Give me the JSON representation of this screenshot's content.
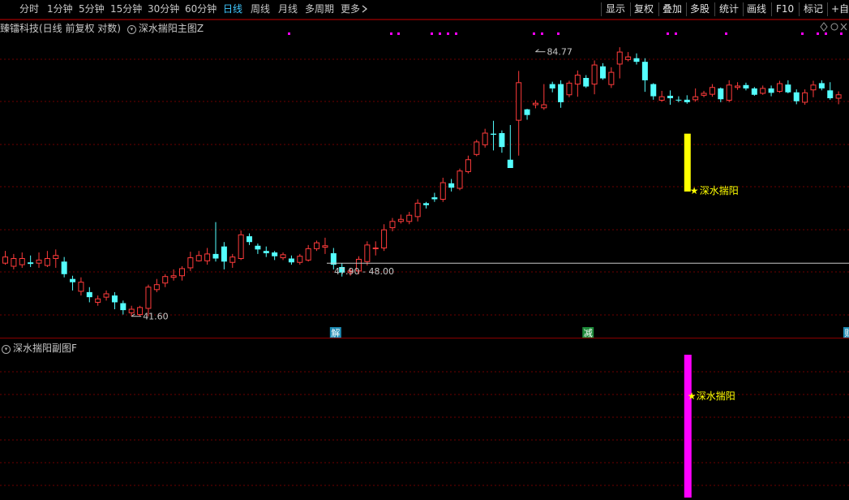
{
  "toolbar": {
    "periods": [
      "分时",
      "1分钟",
      "5分钟",
      "15分钟",
      "30分钟",
      "60分钟",
      "日线",
      "周线",
      "月线",
      "多周期",
      "更多"
    ],
    "active_period": "日线",
    "more_icon": "chevron-right-icon",
    "right_buttons": [
      "显示",
      "复权",
      "叠加",
      "多股",
      "统计",
      "画线",
      "F10",
      "标记",
      "+自选"
    ]
  },
  "main_title": "臻镭科技(日线 前复权 对数)",
  "main_indicator": "深水揣阳主图Z",
  "sub_indicator": "深水揣阳副图F",
  "right_icons": [
    "diamond-icon",
    "circle-icon",
    "close-icon"
  ],
  "colors": {
    "up": "#ff3b3b",
    "down": "#54ffff",
    "signal_main": "#ffff00",
    "signal_sub": "#ff00ff",
    "star": "#ffff00",
    "grid": "#6e0000",
    "event": "#1e8bb4"
  },
  "annotations": {
    "high_label": "84.77",
    "low_label": "41.60",
    "range_label": "47.90 - 48.00",
    "main_signal_label": "深水揣阳",
    "sub_signal_label": "深水揣阳"
  },
  "events": [
    {
      "label": "解",
      "color": "#1e8bb4",
      "index": 39
    },
    {
      "label": "减",
      "color": "#1e8b3a",
      "index": 69
    },
    {
      "label": "财",
      "color": "#1e8bb4",
      "index": 100
    }
  ],
  "chart_data": {
    "type": "candlestick",
    "scale": "log",
    "ylim": [
      40.5,
      88.5
    ],
    "high": 84.77,
    "low": 41.6,
    "signal_index": 81,
    "candles": [
      [
        48.0,
        48.8,
        49.6,
        47.8
      ],
      [
        47.6,
        48.6,
        49.2,
        47.2
      ],
      [
        47.8,
        48.6,
        49.4,
        47.4
      ],
      [
        48.1,
        47.9,
        49.0,
        47.5
      ],
      [
        48.0,
        48.4,
        49.4,
        47.4
      ],
      [
        47.7,
        48.6,
        49.6,
        47.5
      ],
      [
        48.6,
        49.0,
        49.8,
        47.4
      ],
      [
        48.2,
        46.6,
        48.8,
        46.2
      ],
      [
        46.0,
        45.6,
        46.4,
        44.6
      ],
      [
        44.5,
        45.6,
        46.2,
        44.0
      ],
      [
        44.4,
        43.8,
        45.0,
        43.2
      ],
      [
        43.2,
        43.6,
        44.0,
        42.8
      ],
      [
        43.8,
        44.2,
        44.6,
        43.4
      ],
      [
        44.0,
        43.2,
        44.4,
        42.4
      ],
      [
        43.1,
        42.3,
        43.4,
        41.8
      ],
      [
        42.0,
        42.4,
        42.8,
        41.6
      ],
      [
        41.8,
        42.6,
        42.8,
        41.6
      ],
      [
        42.5,
        45.0,
        45.3,
        41.6
      ],
      [
        44.7,
        45.3,
        46.0,
        44.4
      ],
      [
        45.5,
        46.3,
        46.6,
        45.0
      ],
      [
        46.2,
        46.4,
        47.2,
        45.8
      ],
      [
        46.4,
        47.3,
        47.6,
        45.8
      ],
      [
        47.4,
        48.7,
        49.5,
        47.0
      ],
      [
        48.3,
        49.0,
        49.6,
        48.2
      ],
      [
        48.3,
        49.2,
        50.0,
        47.8
      ],
      [
        49.2,
        48.6,
        53.6,
        48.2
      ],
      [
        50.2,
        48.2,
        50.8,
        47.2
      ],
      [
        48.1,
        48.8,
        49.2,
        47.4
      ],
      [
        48.6,
        51.8,
        52.4,
        48.4
      ],
      [
        51.6,
        50.8,
        52.0,
        50.4
      ],
      [
        50.3,
        49.8,
        50.6,
        49.2
      ],
      [
        49.6,
        49.3,
        50.2,
        48.8
      ],
      [
        49.4,
        48.9,
        49.6,
        48.4
      ],
      [
        48.7,
        49.1,
        49.4,
        48.4
      ],
      [
        48.6,
        48.1,
        49.0,
        47.8
      ],
      [
        48.1,
        48.9,
        49.2,
        47.8
      ],
      [
        48.4,
        49.9,
        50.4,
        48.2
      ],
      [
        49.9,
        50.7,
        51.0,
        49.6
      ],
      [
        50.1,
        50.3,
        51.4,
        49.2
      ],
      [
        49.3,
        47.8,
        50.0,
        47.2
      ],
      [
        47.5,
        46.8,
        48.0,
        46.3
      ],
      [
        46.8,
        47.0,
        47.4,
        46.4
      ],
      [
        47.0,
        48.5,
        48.9,
        46.6
      ],
      [
        48.2,
        50.4,
        50.9,
        47.7
      ],
      [
        49.9,
        50.0,
        50.9,
        49.0
      ],
      [
        50.0,
        52.5,
        53.3,
        49.6
      ],
      [
        52.8,
        53.7,
        54.2,
        52.3
      ],
      [
        53.7,
        54.0,
        54.7,
        53.4
      ],
      [
        53.7,
        54.6,
        55.1,
        53.3
      ],
      [
        54.4,
        56.4,
        57.0,
        53.7
      ],
      [
        56.4,
        56.1,
        56.6,
        55.6
      ],
      [
        57.3,
        57.0,
        58.0,
        56.6
      ],
      [
        57.0,
        59.6,
        60.4,
        56.6
      ],
      [
        59.5,
        58.8,
        60.2,
        58.2
      ],
      [
        58.7,
        61.5,
        61.9,
        58.4
      ],
      [
        61.4,
        63.4,
        64.1,
        61.1
      ],
      [
        64.3,
        66.5,
        66.9,
        64.0
      ],
      [
        66.0,
        68.1,
        68.9,
        65.5
      ],
      [
        68.0,
        67.8,
        70.4,
        65.0
      ],
      [
        68.1,
        65.6,
        68.6,
        64.6
      ],
      [
        63.4,
        62.0,
        69.6,
        62.0
      ],
      [
        70.5,
        78.0,
        80.5,
        64.1
      ],
      [
        72.6,
        71.5,
        72.7,
        70.6
      ],
      [
        73.5,
        73.8,
        74.4,
        72.8
      ],
      [
        72.9,
        73.5,
        77.7,
        72.5
      ],
      [
        77.7,
        76.8,
        78.2,
        76.0
      ],
      [
        77.7,
        74.0,
        78.5,
        72.9
      ],
      [
        75.5,
        77.9,
        78.4,
        75.0
      ],
      [
        77.7,
        79.6,
        80.6,
        75.1
      ],
      [
        79.0,
        77.2,
        79.6,
        76.9
      ],
      [
        77.7,
        81.8,
        82.8,
        75.6
      ],
      [
        81.5,
        78.9,
        82.2,
        78.6
      ],
      [
        77.6,
        80.2,
        81.3,
        76.9
      ],
      [
        82.0,
        84.7,
        85.8,
        78.9
      ],
      [
        83.0,
        83.6,
        84.7,
        82.6
      ],
      [
        83.3,
        82.5,
        84.4,
        81.9
      ],
      [
        82.5,
        78.5,
        83.3,
        76.1
      ],
      [
        77.7,
        75.2,
        77.9,
        74.5
      ],
      [
        74.4,
        75.1,
        76.3,
        74.1
      ],
      [
        75.3,
        74.8,
        76.4,
        73.5
      ],
      [
        74.5,
        74.4,
        75.2,
        74.0
      ],
      [
        74.5,
        74.0,
        75.4,
        73.7
      ],
      [
        74.5,
        75.1,
        76.8,
        74.1
      ],
      [
        75.4,
        75.8,
        76.3,
        75.0
      ],
      [
        75.6,
        77.0,
        77.7,
        75.1
      ],
      [
        76.8,
        74.6,
        77.0,
        74.0
      ],
      [
        74.4,
        77.5,
        78.5,
        74.0
      ],
      [
        77.0,
        77.3,
        78.1,
        76.5
      ],
      [
        77.5,
        76.8,
        78.0,
        76.4
      ],
      [
        76.8,
        75.5,
        77.1,
        75.3
      ],
      [
        75.8,
        76.8,
        77.4,
        75.5
      ],
      [
        76.8,
        75.9,
        77.4,
        75.2
      ],
      [
        76.2,
        77.8,
        78.4,
        75.9
      ],
      [
        77.6,
        76.0,
        78.5,
        75.8
      ],
      [
        76.0,
        74.2,
        76.6,
        73.6
      ],
      [
        74.0,
        75.9,
        76.6,
        73.5
      ],
      [
        76.5,
        77.5,
        78.4,
        75.0
      ],
      [
        77.9,
        76.8,
        78.5,
        76.4
      ],
      [
        76.4,
        74.8,
        78.1,
        74.5
      ],
      [
        74.8,
        75.5,
        76.2,
        73.6
      ]
    ]
  }
}
